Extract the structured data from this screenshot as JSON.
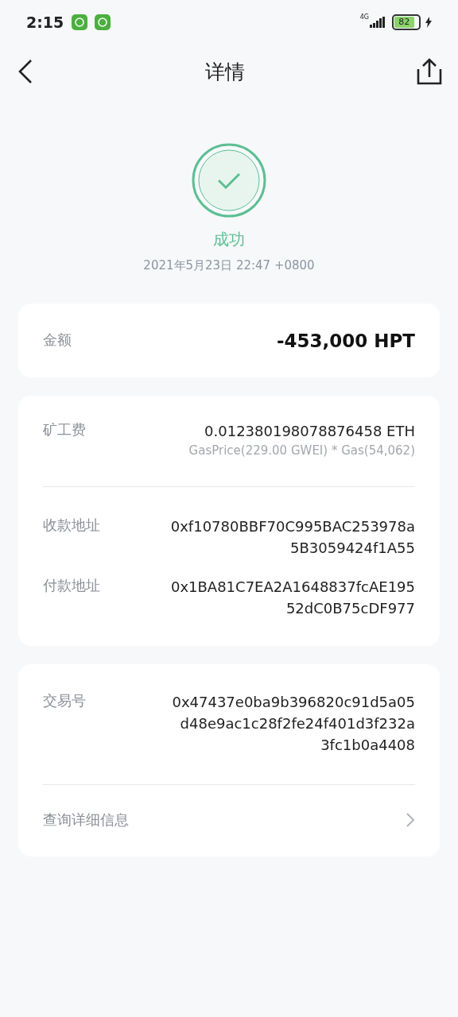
{
  "status_bar": {
    "time": "2:15",
    "network": "4G",
    "battery": "82",
    "charging": true
  },
  "header": {
    "title": "详情"
  },
  "result": {
    "status": "成功",
    "success": true,
    "datetime": "2021年5月23日 22:47 +0800"
  },
  "cards": [
    {
      "rows": [
        {
          "kind": "amount",
          "label": "金额",
          "value": "-453,000",
          "unit": "HPT"
        }
      ]
    },
    {
      "rows": [
        {
          "kind": "fee",
          "label": "矿工费",
          "value": "0.012380198078876458 ETH",
          "note": "GasPrice(229.00 GWEI) * Gas(54,062)"
        },
        {
          "kind": "divider"
        },
        {
          "kind": "address",
          "label": "收款地址",
          "lines": [
            "0xf10780BBF70C995BAC253978a",
            "5B3059424f1A55"
          ]
        },
        {
          "kind": "address",
          "label": "付款地址",
          "lines": [
            "0x1BA81C7EA2A1648837fcAE195",
            "52dC0B75cDF977"
          ]
        }
      ]
    },
    {
      "rows": [
        {
          "kind": "address",
          "label": "交易号",
          "lines": [
            "0x47437e0ba9b396820c91d5a05",
            "d48e9ac1c28f2fe24f401d3f232a",
            "3fc1b0a4408"
          ]
        },
        {
          "kind": "divider"
        },
        {
          "kind": "link",
          "label": "查询详细信息"
        }
      ]
    }
  ]
}
